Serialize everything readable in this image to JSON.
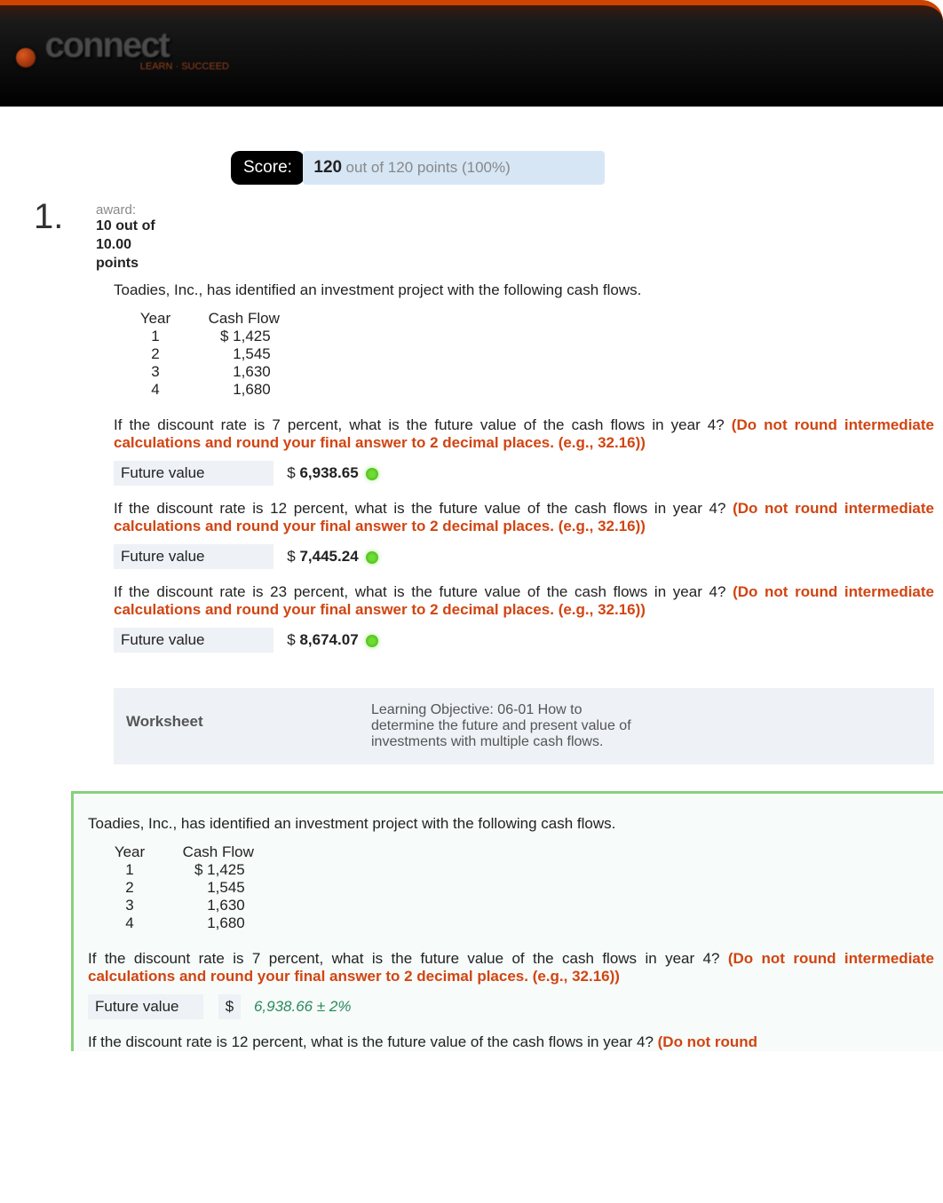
{
  "logo": {
    "text": "connect",
    "sub": "LEARN · SUCCEED"
  },
  "score": {
    "label": "Score:",
    "value": "120",
    "rest": "out of 120 points (100%)"
  },
  "question": {
    "number": "1.",
    "award_label": "award:",
    "award_points_l1": "10 out of",
    "award_points_l2": "10.00",
    "award_points_l3": "points",
    "intro": "Toadies, Inc., has identified an investment project with the following cash flows.",
    "table": {
      "h1": "Year",
      "h2": "Cash Flow",
      "rows": [
        {
          "year": "1",
          "cf": "$ 1,425"
        },
        {
          "year": "2",
          "cf": "1,545"
        },
        {
          "year": "3",
          "cf": "1,630"
        },
        {
          "year": "4",
          "cf": "1,680"
        }
      ]
    },
    "prompts": [
      {
        "lead": "If the discount rate is 7 percent, what is the future value of the cash flows in year 4? ",
        "instruct": "(Do not round intermediate calculations and round your final answer to 2 decimal places. (e.g., 32.16))",
        "label": "Future value",
        "currency": "$",
        "value": "6,938.65"
      },
      {
        "lead": "If the discount rate is 12 percent, what is the future value of the cash flows in year 4? ",
        "instruct": "(Do not round intermediate calculations and round your final answer to 2 decimal places. (e.g., 32.16))",
        "label": "Future value",
        "currency": "$",
        "value": "7,445.24"
      },
      {
        "lead": "If the discount rate is 23 percent, what is the future value of the cash flows in year 4? ",
        "instruct": "(Do not round intermediate calculations and round your final answer to 2 decimal places. (e.g., 32.16))",
        "label": "Future value",
        "currency": "$",
        "value": "8,674.07"
      }
    ],
    "meta": {
      "left": "Worksheet",
      "right": "Learning Objective: 06-01 How to determine the future and present value of investments with multiple cash flows."
    }
  },
  "solution": {
    "intro": "Toadies, Inc., has identified an investment project with the following cash flows.",
    "table": {
      "h1": "Year",
      "h2": "Cash Flow",
      "rows": [
        {
          "year": "1",
          "cf": "$ 1,425"
        },
        {
          "year": "2",
          "cf": "1,545"
        },
        {
          "year": "3",
          "cf": "1,630"
        },
        {
          "year": "4",
          "cf": "1,680"
        }
      ]
    },
    "prompts": [
      {
        "lead": "If the discount rate is 7 percent, what is the future value of the cash flows in year 4? ",
        "instruct": "(Do not round intermediate calculations and round your final answer to 2 decimal places. (e.g., 32.16))",
        "label": "Future value",
        "currency": "$",
        "value": "6,938.66 ± 2%"
      },
      {
        "lead": "If the discount rate is 12 percent, what is the future value of the cash flows in year 4? ",
        "instruct": "(Do not round"
      }
    ]
  }
}
